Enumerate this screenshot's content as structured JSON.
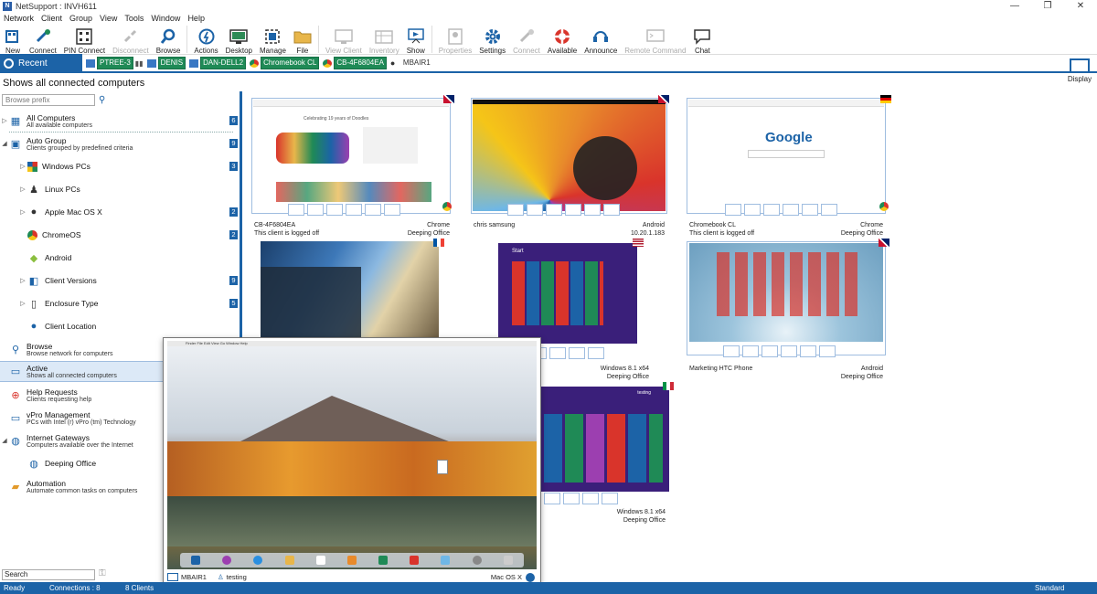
{
  "window": {
    "title": "NetSupport : INVH611",
    "app_icon": "N",
    "controls": [
      "—",
      "❐",
      "✕"
    ]
  },
  "menu": [
    "Network",
    "Client",
    "Group",
    "View",
    "Tools",
    "Window",
    "Help"
  ],
  "toolbar": {
    "buttons": [
      {
        "label": "New",
        "icon": "new-icon",
        "enabled": true
      },
      {
        "label": "Connect",
        "icon": "connect-icon",
        "enabled": true
      },
      {
        "label": "PIN Connect",
        "icon": "pin-connect-icon",
        "enabled": true
      },
      {
        "label": "Disconnect",
        "icon": "disconnect-icon",
        "enabled": false
      },
      {
        "label": "Browse",
        "icon": "browse-icon",
        "enabled": true
      },
      {
        "label": "Actions",
        "icon": "actions-icon",
        "enabled": true
      },
      {
        "label": "Desktop",
        "icon": "desktop-icon",
        "enabled": true
      },
      {
        "label": "Manage",
        "icon": "manage-icon",
        "enabled": true
      },
      {
        "label": "File",
        "icon": "file-icon",
        "enabled": true
      },
      {
        "label": "View Client",
        "icon": "view-client-icon",
        "enabled": false
      },
      {
        "label": "Inventory",
        "icon": "inventory-icon",
        "enabled": false
      },
      {
        "label": "Show",
        "icon": "show-icon",
        "enabled": true
      },
      {
        "label": "Properties",
        "icon": "properties-icon",
        "enabled": false
      },
      {
        "label": "Settings",
        "icon": "settings-icon",
        "enabled": true
      },
      {
        "label": "Connect",
        "icon": "connect2-icon",
        "enabled": false
      },
      {
        "label": "Available",
        "icon": "available-icon",
        "enabled": true
      },
      {
        "label": "Announce",
        "icon": "announce-icon",
        "enabled": true
      },
      {
        "label": "Remote Command",
        "icon": "remote-command-icon",
        "enabled": false
      },
      {
        "label": "Chat",
        "icon": "chat-icon",
        "enabled": true
      }
    ]
  },
  "tabs": {
    "recent_label": "Recent",
    "chips": [
      {
        "label": "PTREE-3"
      },
      {
        "label": "DENIS"
      },
      {
        "label": "DAN-DELL2"
      },
      {
        "label": "Chromebook CL"
      },
      {
        "label": "CB-4F6804EA"
      },
      {
        "label": "MBAIR1"
      }
    ],
    "display_label": "Display"
  },
  "header": {
    "text": "Shows all connected computers"
  },
  "sidebar": {
    "browse_placeholder": "Browse prefix",
    "items": [
      {
        "label": "All Computers",
        "sub": "All available computers",
        "count": "6"
      },
      {
        "label": "Auto Group",
        "sub": "Clients grouped by predefined criteria",
        "count": "9"
      },
      {
        "label": "Windows PCs",
        "sub": "",
        "count": "3"
      },
      {
        "label": "Linux PCs",
        "sub": "",
        "count": ""
      },
      {
        "label": "Apple Mac OS X",
        "sub": "",
        "count": "2"
      },
      {
        "label": "ChromeOS",
        "sub": "",
        "count": "2"
      },
      {
        "label": "Android",
        "sub": "",
        "count": ""
      },
      {
        "label": "Client Versions",
        "sub": "",
        "count": "9"
      },
      {
        "label": "Enclosure Type",
        "sub": "",
        "count": "5"
      },
      {
        "label": "Client Location",
        "sub": "",
        "count": ""
      },
      {
        "label": "Browse",
        "sub": "Browse network for computers",
        "count": ""
      },
      {
        "label": "Active",
        "sub": "Shows all connected computers",
        "count": ""
      },
      {
        "label": "Help Requests",
        "sub": "Clients requesting help",
        "count": ""
      },
      {
        "label": "vPro Management",
        "sub": "PCs with Intel (r) vPro (tm) Technology",
        "count": ""
      },
      {
        "label": "Internet Gateways",
        "sub": "Computers available over the Internet",
        "count": ""
      },
      {
        "label": "Deeping Office",
        "sub": "",
        "count": ""
      },
      {
        "label": "Automation",
        "sub": "Automate common tasks on computers",
        "count": ""
      }
    ],
    "search_value": "Search"
  },
  "thumbnails": [
    {
      "name": "CB-4F6804EA",
      "os": "Chrome",
      "status": "This client is logged off",
      "location": "Deeping Office",
      "screen_text": "Celebrating 19 years of Doodles"
    },
    {
      "name": "chris samsung",
      "os": "Android",
      "status": "",
      "location": "10.20.1.183"
    },
    {
      "name": "Chromebook CL",
      "os": "Chrome",
      "status": "This client is logged off",
      "location": "Deeping Office",
      "screen_text": "Google"
    },
    {
      "name": "Marketing HTC Phone",
      "os": "Android",
      "status": "",
      "location": "Deeping Office"
    },
    {
      "name": "",
      "os": "Windows 8.1 x64",
      "status": "",
      "location": "Deeping Office",
      "screen_text": "Start"
    },
    {
      "name": "",
      "os": "Windows 8.1 x64",
      "status": "",
      "location": "Deeping Office",
      "screen_text": "testing"
    }
  ],
  "mac_window": {
    "client": "MBAIR1",
    "user": "testing",
    "os": "Mac OS X",
    "menubar": "Finder  File  Edit  View  Go  Window  Help"
  },
  "status": {
    "ready": "Ready",
    "connections": "Connections : 8",
    "clients": "8 Clients",
    "mode": "Standard"
  }
}
